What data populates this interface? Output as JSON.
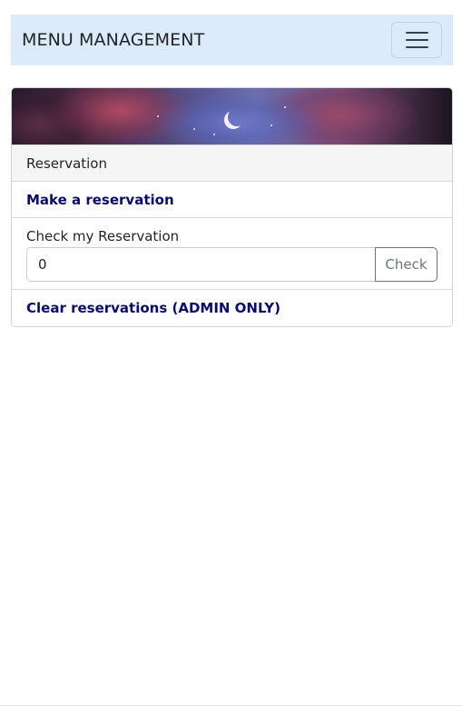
{
  "navbar": {
    "brand": "MENU MANAGEMENT",
    "toggler_icon": "hamburger-menu-icon",
    "background": "#dcebfb"
  },
  "card": {
    "banner_icon": "crescent-moon-icon",
    "header": "Reservation",
    "make_reservation_link": "Make a reservation",
    "check": {
      "label": "Check my Reservation",
      "input_value": "0",
      "button_label": "Check"
    },
    "clear_link": "Clear reservations (ADMIN ONLY)",
    "link_color": "#0b0b6e"
  }
}
